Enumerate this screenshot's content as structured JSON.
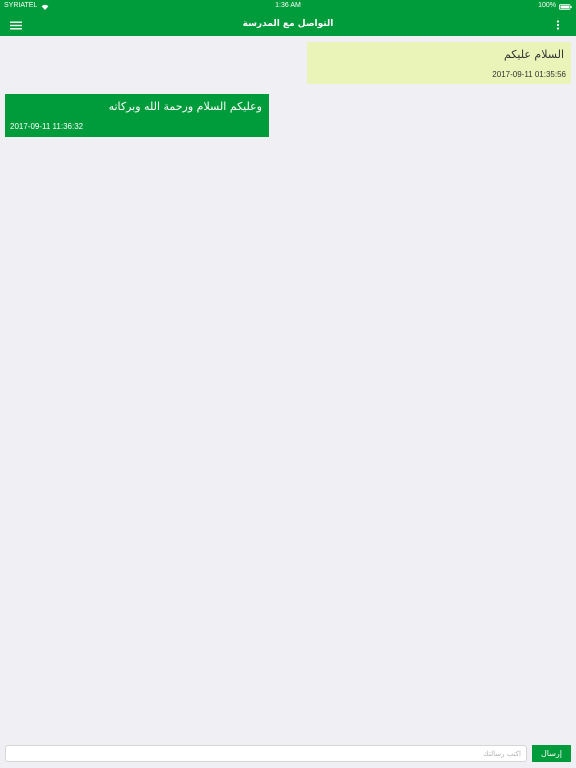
{
  "colors": {
    "brand_green": "#009b3a",
    "sent_bubble": "#eaf4b8",
    "background": "#efeff4"
  },
  "status_bar": {
    "carrier": "SYRIATEL",
    "time": "1:36 AM",
    "battery_percent": "100%",
    "icons": [
      "wifi-icon",
      "battery-icon"
    ]
  },
  "nav_bar": {
    "title": "التواصل مع المدرسة",
    "icons": [
      "hamburger-menu-icon",
      "more-vertical-icon"
    ]
  },
  "messages": [
    {
      "direction": "sent",
      "text": "السلام عليكم",
      "timestamp": "2017-09-11 01:35:56"
    },
    {
      "direction": "received",
      "text": "وعليكم السلام ورحمة الله وبركاته",
      "timestamp": "2017-09-11 11:36:32"
    }
  ],
  "composer": {
    "input_value": "",
    "input_placeholder": "اكتب رسالتك",
    "send_label": "إرسال"
  }
}
